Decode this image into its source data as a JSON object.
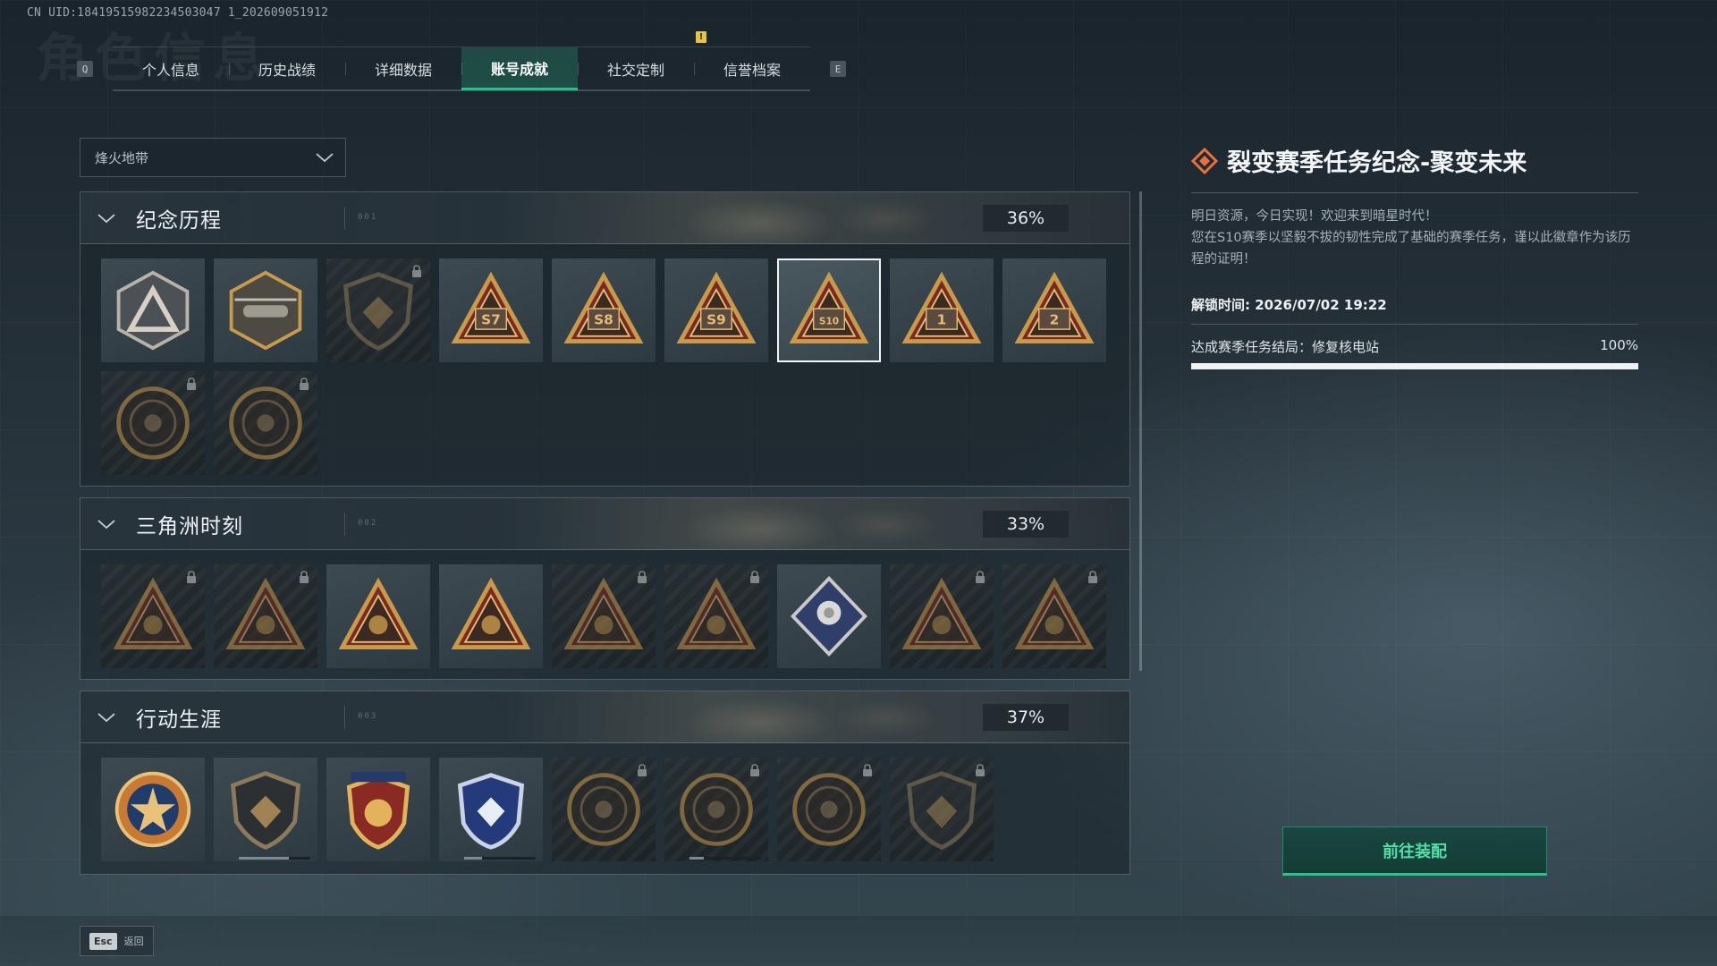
{
  "uid": "CN UID:18419515982234503047 1_202609051912",
  "page_bg_title": "角色信息",
  "tabs": {
    "prev_key": "Q",
    "next_key": "E",
    "items": [
      "个人信息",
      "历史战绩",
      "详细数据",
      "账号成就",
      "社交定制",
      "信誉档案"
    ],
    "active_index": 3,
    "alert_tab_index": 4,
    "alert_symbol": "!"
  },
  "dropdown": {
    "value": "烽火地带"
  },
  "categories": [
    {
      "title": "纪念历程",
      "code": "001",
      "percent": "36%",
      "badges": [
        {
          "icon": "triangle-emblem-icon",
          "locked": false
        },
        {
          "icon": "helicopter-shield-icon",
          "locked": false
        },
        {
          "icon": "dark-shield-emblem-icon",
          "locked": true
        },
        {
          "icon": "season-s7-badge-icon",
          "locked": false,
          "label": "S7"
        },
        {
          "icon": "season-s8-badge-icon",
          "locked": false,
          "label": "S8"
        },
        {
          "icon": "season-s9-badge-icon",
          "locked": false,
          "label": "S9"
        },
        {
          "icon": "season-s10-badge-icon",
          "locked": false,
          "label": "S10",
          "selected": true
        },
        {
          "icon": "anniversary-1-badge-icon",
          "locked": false,
          "label": "1"
        },
        {
          "icon": "anniversary-2-badge-icon",
          "locked": false,
          "label": "2"
        },
        {
          "icon": "delta-force-seal-icon",
          "locked": true
        },
        {
          "icon": "year-2026-seal-icon",
          "locked": true
        }
      ]
    },
    {
      "title": "三角洲时刻",
      "code": "002",
      "percent": "33%",
      "badges": [
        {
          "icon": "bottle-triangle-icon",
          "locked": true
        },
        {
          "icon": "runner-triangle-icon",
          "locked": true
        },
        {
          "icon": "hands-triangle-icon",
          "locked": false
        },
        {
          "icon": "squad-triangle-icon",
          "locked": false
        },
        {
          "icon": "team-triangle-icon",
          "locked": true
        },
        {
          "icon": "beast-triangle-icon",
          "locked": true
        },
        {
          "icon": "rose-diamond-icon",
          "locked": false
        },
        {
          "icon": "bird-triangle-icon",
          "locked": true
        },
        {
          "icon": "skull-triangle-icon",
          "locked": true
        }
      ]
    },
    {
      "title": "行动生涯",
      "code": "003",
      "percent": "37%",
      "badges": [
        {
          "icon": "star-medal-icon",
          "locked": false
        },
        {
          "icon": "shield-medal-icon",
          "locked": false,
          "progress": 0.7
        },
        {
          "icon": "gold-star-shield-icon",
          "locked": false
        },
        {
          "icon": "blue-star-shield-icon",
          "locked": false,
          "progress": 0.25
        },
        {
          "icon": "round-seal-icon",
          "locked": true
        },
        {
          "icon": "skull-crosshair-seal-icon",
          "locked": true,
          "progress": 0.2
        },
        {
          "icon": "eagle-seal-icon",
          "locked": true
        },
        {
          "icon": "wolf-shield-icon",
          "locked": true
        }
      ]
    }
  ],
  "detail": {
    "title": "裂变赛季任务纪念-聚变未来",
    "description": "明日资源，今日实现！欢迎来到暗星时代！\n您在S10赛季以坚毅不拔的韧性完成了基础的赛季任务，谨以此徽章作为该历程的证明！",
    "unlock_label": "解锁时间: 2026/07/02 19:22",
    "task_label": "达成赛季任务结局：修复核电站",
    "task_percent": "100%",
    "task_progress": 1.0,
    "accent_color": "#e8703a"
  },
  "equip_button": "前往装配",
  "footer": {
    "esc_key": "Esc",
    "back_label": "返回"
  },
  "colors": {
    "active_tab": "#21c48a",
    "equip_text": "#4ee0a6",
    "alert": "#e8c342"
  }
}
